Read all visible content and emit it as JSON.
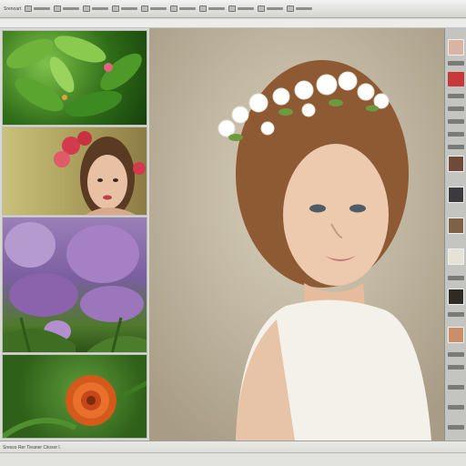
{
  "toolbar": {
    "items": [
      {
        "name": "toolbar-item-1",
        "label": "Srenoart"
      },
      {
        "name": "toolbar-item-2",
        "label": ""
      },
      {
        "name": "toolbar-item-3",
        "label": ""
      },
      {
        "name": "toolbar-item-4",
        "label": ""
      },
      {
        "name": "toolbar-item-5",
        "label": ""
      },
      {
        "name": "toolbar-item-6",
        "label": ""
      },
      {
        "name": "toolbar-item-7",
        "label": ""
      },
      {
        "name": "toolbar-item-8",
        "label": ""
      },
      {
        "name": "toolbar-item-9",
        "label": ""
      },
      {
        "name": "toolbar-item-10",
        "label": ""
      },
      {
        "name": "toolbar-item-11",
        "label": ""
      }
    ]
  },
  "thumbnails": [
    {
      "name": "thumb-leaves",
      "icon": "green-leaves-photo"
    },
    {
      "name": "thumb-portrait",
      "icon": "woman-with-flowers-photo"
    },
    {
      "name": "thumb-purple",
      "icon": "purple-flowers-photo"
    },
    {
      "name": "thumb-orange",
      "icon": "orange-flower-photo"
    }
  ],
  "viewer": {
    "icon": "woman-flower-crown-photo"
  },
  "statusbar": {
    "text": "Sresso Rer Tieaner Ciiosor l."
  },
  "colors": {
    "toolbar_bg": "#d3d3d0",
    "viewer_bg": "#cfc6b2",
    "rightbar_bg": "#c4c4c0"
  }
}
